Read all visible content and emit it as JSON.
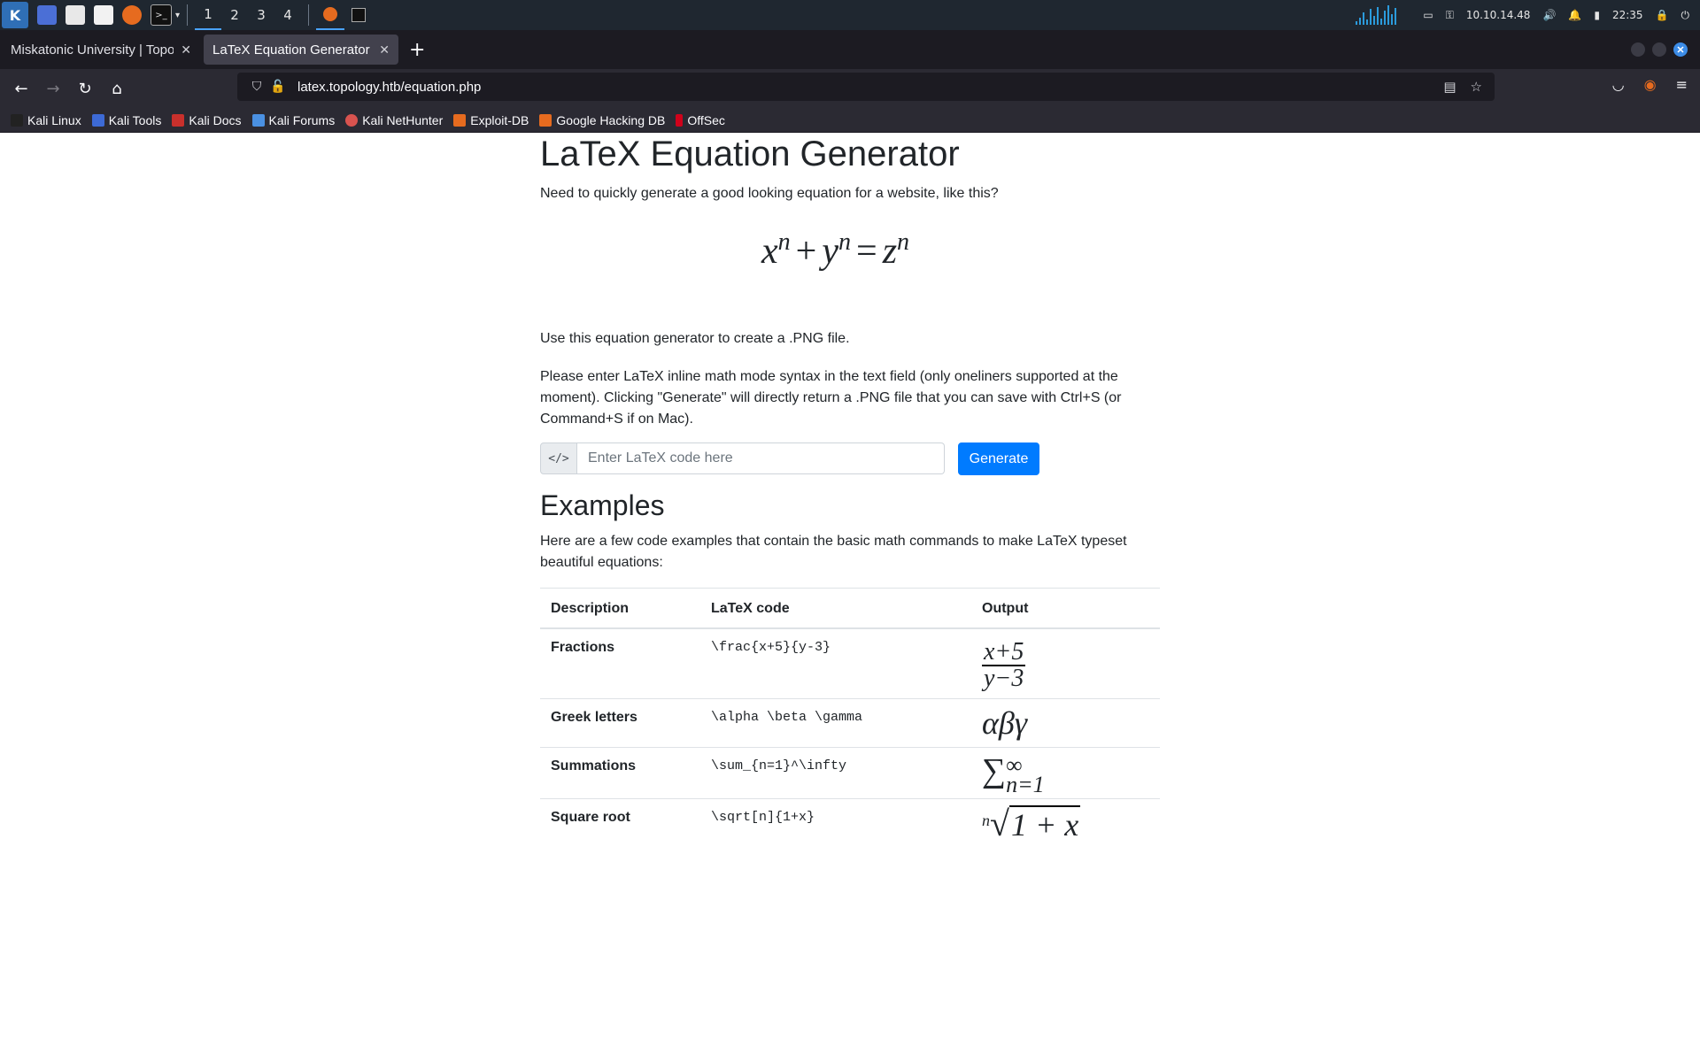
{
  "taskbar": {
    "workspaces": [
      "1",
      "2",
      "3",
      "4"
    ],
    "ip": "10.10.14.48",
    "time": "22:35"
  },
  "browser": {
    "tabs": [
      {
        "title": "Miskatonic University | Topology"
      },
      {
        "title": "LaTeX Equation Generator"
      }
    ],
    "url": "latex.topology.htb/equation.php",
    "bookmarks": [
      "Kali Linux",
      "Kali Tools",
      "Kali Docs",
      "Kali Forums",
      "Kali NetHunter",
      "Exploit-DB",
      "Google Hacking DB",
      "OffSec"
    ]
  },
  "page": {
    "title": "LaTeX Equation Generator",
    "intro": "Need to quickly generate a good looking equation for a website, like this?",
    "hero_equation": {
      "a": "x",
      "b": "y",
      "c": "z",
      "exp": "n",
      "plus": "+",
      "eq": "="
    },
    "p2": "Use this equation generator to create a .PNG file.",
    "p3": "Please enter LaTeX inline math mode syntax in the text field (only oneliners supported at the moment). Clicking \"Generate\" will directly return a .PNG file that you can save with Ctrl+S (or Command+S if on Mac).",
    "input_prepend": "</>",
    "input_placeholder": "Enter LaTeX code here",
    "generate_label": "Generate",
    "examples_title": "Examples",
    "examples_intro": "Here are a few code examples that contain the basic math commands to make LaTeX typeset beautiful equations:",
    "table": {
      "headers": [
        "Description",
        "LaTeX code",
        "Output"
      ],
      "rows": [
        {
          "desc": "Fractions",
          "code": "\\frac{x+5}{y-3}"
        },
        {
          "desc": "Greek letters",
          "code": "\\alpha \\beta \\gamma"
        },
        {
          "desc": "Summations",
          "code": "\\sum_{n=1}^\\infty"
        },
        {
          "desc": "Square root",
          "code": "\\sqrt[n]{1+x}"
        }
      ],
      "outputs": {
        "frac_num": "x+5",
        "frac_den": "y−3",
        "greek": "αβγ",
        "sum_symbol": "∑",
        "sum_upper": "∞",
        "sum_lower": "n=1",
        "sqrt_index": "n",
        "sqrt_symbol": "√",
        "sqrt_radicand": "1 + x"
      }
    }
  }
}
